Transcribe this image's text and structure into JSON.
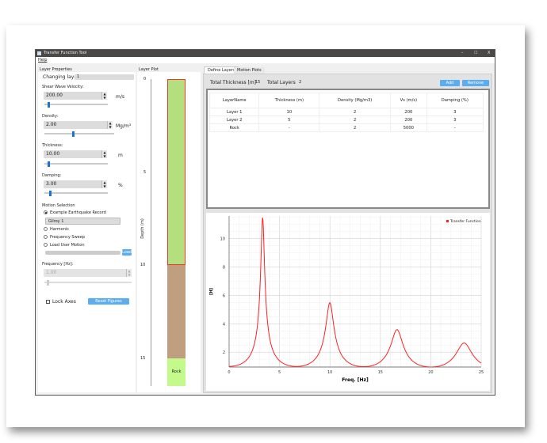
{
  "window": {
    "title": "Transfer Function Tool",
    "controls": [
      "–",
      "☐",
      "X"
    ],
    "menu": [
      "Help"
    ]
  },
  "layer_properties": {
    "title": "Layer Properties",
    "changing_layer_label": "Changing layer",
    "changing_layer_value": "1",
    "vs": {
      "label": "Shear Wave Velocity:",
      "value": "200.00",
      "unit": "m/s",
      "slider": 0.05
    },
    "density": {
      "label": "Density:",
      "value": "2.00",
      "unit": "Mg/m³",
      "slider": 0.4
    },
    "thickness": {
      "label": "Thickness:",
      "value": "10.00",
      "unit": "m",
      "slider": 0.05
    },
    "damping": {
      "label": "Damping:",
      "value": "3.00",
      "unit": "%",
      "slider": 0.08
    },
    "motion": {
      "title": "Motion Selection",
      "options": [
        "Example Earthquake Record",
        "Harmonic",
        "Frequency Sweep",
        "Load User Motion"
      ],
      "selected": 0,
      "record": "Gilroy 1",
      "load_button": "Load"
    },
    "frequency": {
      "label": "Frequency [Hz]:",
      "value": "1.00",
      "slider": 0.03
    },
    "lock_axes": "Lock Axes",
    "reset_button": "Reset Figures"
  },
  "layer_plot": {
    "title": "Layer Plot",
    "axis_label": "Depth (m)",
    "ticks": [
      "0",
      "5",
      "10",
      "15"
    ],
    "rock_label": "Rock",
    "colors": {
      "soil1": "#b3df7f",
      "soil2": "#c09f80",
      "rock": "#c4fa8c",
      "selected": "#e8392c"
    }
  },
  "tabs": [
    "Define Layers",
    "Motion Plots"
  ],
  "summary": {
    "thickness_label": "Total Thickness [m]",
    "thickness_value": "15",
    "layers_label": "Total Layers",
    "layers_value": "2",
    "add_button": "Add Layer",
    "remove_button": "Remove Layer"
  },
  "table": {
    "headers": [
      "LayerName",
      "Thickness (m)",
      "Density (Mg/m3)",
      "Vs (m/s)",
      "Damping (%)"
    ],
    "rows": [
      [
        "Layer 1",
        "10",
        "2",
        "200",
        "3"
      ],
      [
        "Layer 2",
        "5",
        "2",
        "200",
        "3"
      ],
      [
        "Rock",
        "-",
        "2",
        "5000",
        "-"
      ]
    ]
  },
  "chart_data": {
    "type": "line",
    "title": "",
    "xlabel": "Freq. [Hz]",
    "ylabel": "[H]",
    "xlim": [
      0,
      25
    ],
    "ylim": [
      0.95,
      11.6
    ],
    "xticks": [
      "0",
      "5",
      "10",
      "15",
      "20",
      "25"
    ],
    "yticks": [
      "2",
      "4",
      "6",
      "8",
      "10"
    ],
    "legend": "Transfer Function",
    "legend_position": "top-right",
    "grid": true,
    "color": "#ff2020",
    "model": {
      "soil_thickness_m": 15,
      "soil_vs_ms": 200,
      "soil_density": 2,
      "damping": 0.03,
      "rock_vs_ms": 5000,
      "rock_density": 2
    },
    "peaks": [
      {
        "x": 3.33,
        "y": 11.5
      },
      {
        "x": 10,
        "y": 5.5
      },
      {
        "x": 16.67,
        "y": 3.6
      },
      {
        "x": 23.33,
        "y": 2.7
      }
    ]
  }
}
